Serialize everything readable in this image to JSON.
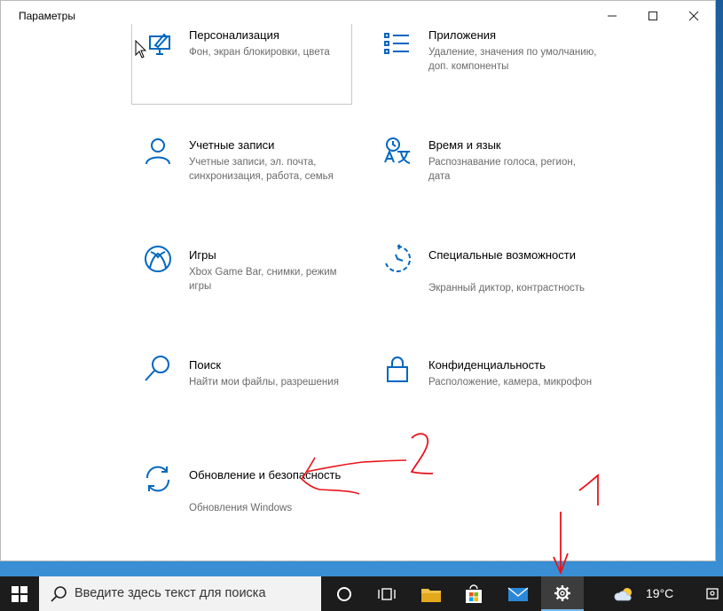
{
  "window": {
    "title": "Параметры",
    "controls": {
      "minimize": "–",
      "maximize": "☐",
      "close": "✕"
    }
  },
  "settings": {
    "tiles": [
      {
        "icon": "personalization-icon",
        "name": "Персонализация",
        "desc": "Фон, экран блокировки, цвета"
      },
      {
        "icon": "apps-icon",
        "name": "Приложения",
        "desc": "Удаление, значения по умолчанию, доп. компоненты"
      },
      {
        "icon": "accounts-icon",
        "name": "Учетные записи",
        "desc": "Учетные записи, эл. почта, синхронизация, работа, семья"
      },
      {
        "icon": "time-language-icon",
        "name": "Время и язык",
        "desc": "Распознавание голоса, регион, дата"
      },
      {
        "icon": "xbox-icon",
        "name": "Игры",
        "desc": "Xbox Game Bar, снимки, режим игры"
      },
      {
        "icon": "ease-of-access-icon",
        "name": "Специальные возможности",
        "desc": "Экранный диктор, контрастность"
      },
      {
        "icon": "search-icon",
        "name": "Поиск",
        "desc": "Найти мои файлы, разрешения"
      },
      {
        "icon": "lock-icon",
        "name": "Конфиденциальность",
        "desc": "Расположение, камера, микрофон"
      },
      {
        "icon": "update-icon",
        "name": "Обновление и безопасность",
        "desc": "Обновления Windows"
      }
    ]
  },
  "annotations": {
    "label_1": "1",
    "label_2": "2",
    "color": "#e8141c"
  },
  "taskbar": {
    "search_placeholder": "Введите здесь текст для поиска",
    "weather_temp": "19°C",
    "icons": [
      "windows-start-icon",
      "search-icon",
      "cortana-icon",
      "task-view-icon",
      "file-explorer-icon",
      "store-icon",
      "mail-icon",
      "settings-gear-icon",
      "weather-icon",
      "notifications-icon"
    ]
  }
}
